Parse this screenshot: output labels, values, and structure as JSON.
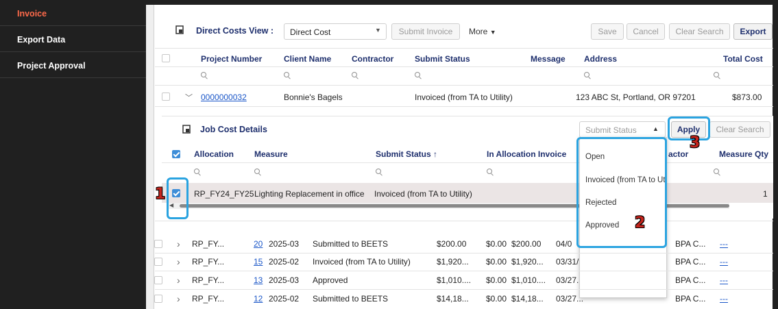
{
  "sidebar": {
    "items": [
      {
        "label": "Invoice"
      },
      {
        "label": "Export Data"
      },
      {
        "label": "Project Approval"
      }
    ]
  },
  "view": {
    "title": "Direct Costs View :",
    "select_value": "Direct Cost",
    "submit_invoice": "Submit Invoice",
    "more": "More",
    "save": "Save",
    "cancel": "Cancel",
    "clear_search": "Clear Search",
    "export": "Export"
  },
  "top_table": {
    "headers": [
      "Project Number",
      "Client Name",
      "Contractor",
      "Submit Status",
      "Message",
      "Address",
      "Total Cost"
    ],
    "row": {
      "project_number": "0000000032",
      "client_name": "Bonnie's Bagels",
      "submit_status": "Invoiced (from TA to Utility)",
      "address": "123 ABC St, Portland, OR 97201",
      "total_cost": "$873.00"
    }
  },
  "job_cost": {
    "title": "Job Cost Details",
    "filter_placeholder": "Submit Status",
    "apply": "Apply",
    "clear_search": "Clear Search",
    "headers": [
      "Allocation",
      "Measure",
      "Submit Status",
      "In Allocation Invoice",
      "actor",
      "Measure Qty"
    ],
    "sort_arrow": "↑",
    "row": {
      "allocation": "RP_FY24_FY25",
      "measure": "Lighting Replacement in office",
      "submit_status": "Invoiced (from TA to Utility)",
      "qty": "1"
    }
  },
  "dropdown": {
    "options": [
      "Open",
      "Invoiced (from TA to Utility)",
      "Rejected",
      "Approved"
    ]
  },
  "bottom_rows": [
    {
      "alloc": "RP_FY...",
      "num": "20",
      "period": "2025-03",
      "status": "Submitted to BEETS",
      "amount": "$200.00",
      "zero": "$0.00",
      "total": "$200.00",
      "date": "04/0",
      "org": "BPA C...",
      "link": "---"
    },
    {
      "alloc": "RP_FY...",
      "num": "15",
      "period": "2025-02",
      "status": "Invoiced (from TA to Utility)",
      "amount": "$1,920...",
      "zero": "$0.00",
      "total": "$1,920...",
      "date": "03/31/",
      "org": "BPA C...",
      "link": "---"
    },
    {
      "alloc": "RP_FY...",
      "num": "13",
      "period": "2025-03",
      "status": "Approved",
      "amount": "$1,010....",
      "zero": "$0.00",
      "total": "$1,010....",
      "date": "03/27.",
      "org": "BPA C...",
      "link": "---"
    },
    {
      "alloc": "RP_FY...",
      "num": "12",
      "period": "2025-02",
      "status": "Submitted to BEETS",
      "amount": "$14,18...",
      "zero": "$0.00",
      "total": "$14,18...",
      "date": "03/27...",
      "org": "BPA C...",
      "link": "---"
    }
  ],
  "callouts": [
    "1",
    "2",
    "3"
  ],
  "colors": {
    "accent": "#2aa3e0",
    "active_nav": "#ff6a4a",
    "header_text": "#1e2f6d",
    "badge": "#c5241c"
  }
}
